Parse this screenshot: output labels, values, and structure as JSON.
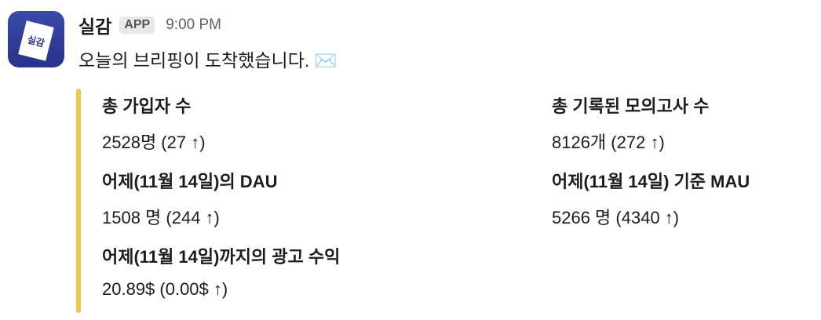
{
  "message": {
    "avatar_text": "실감",
    "sender": "실감",
    "badge": "APP",
    "time": "9:00 PM",
    "text": "오늘의 브리핑이 도착했습니다. ✉️"
  },
  "attachment": {
    "color": "#f2c744",
    "fields": [
      {
        "title": "총 가입자 수",
        "value": "2528명 (27 ↑)"
      },
      {
        "title": "총 기록된 모의고사 수",
        "value": "8126개 (272 ↑)"
      },
      {
        "title": "어제(11월 14일)의 DAU",
        "value": "1508 명 (244 ↑)"
      },
      {
        "title": "어제(11월 14일) 기준 MAU",
        "value": "5266 명 (4340 ↑)"
      },
      {
        "title": "어제(11월 14일)까지의 광고 수익",
        "value": "20.89$ (0.00$ ↑)"
      }
    ]
  }
}
